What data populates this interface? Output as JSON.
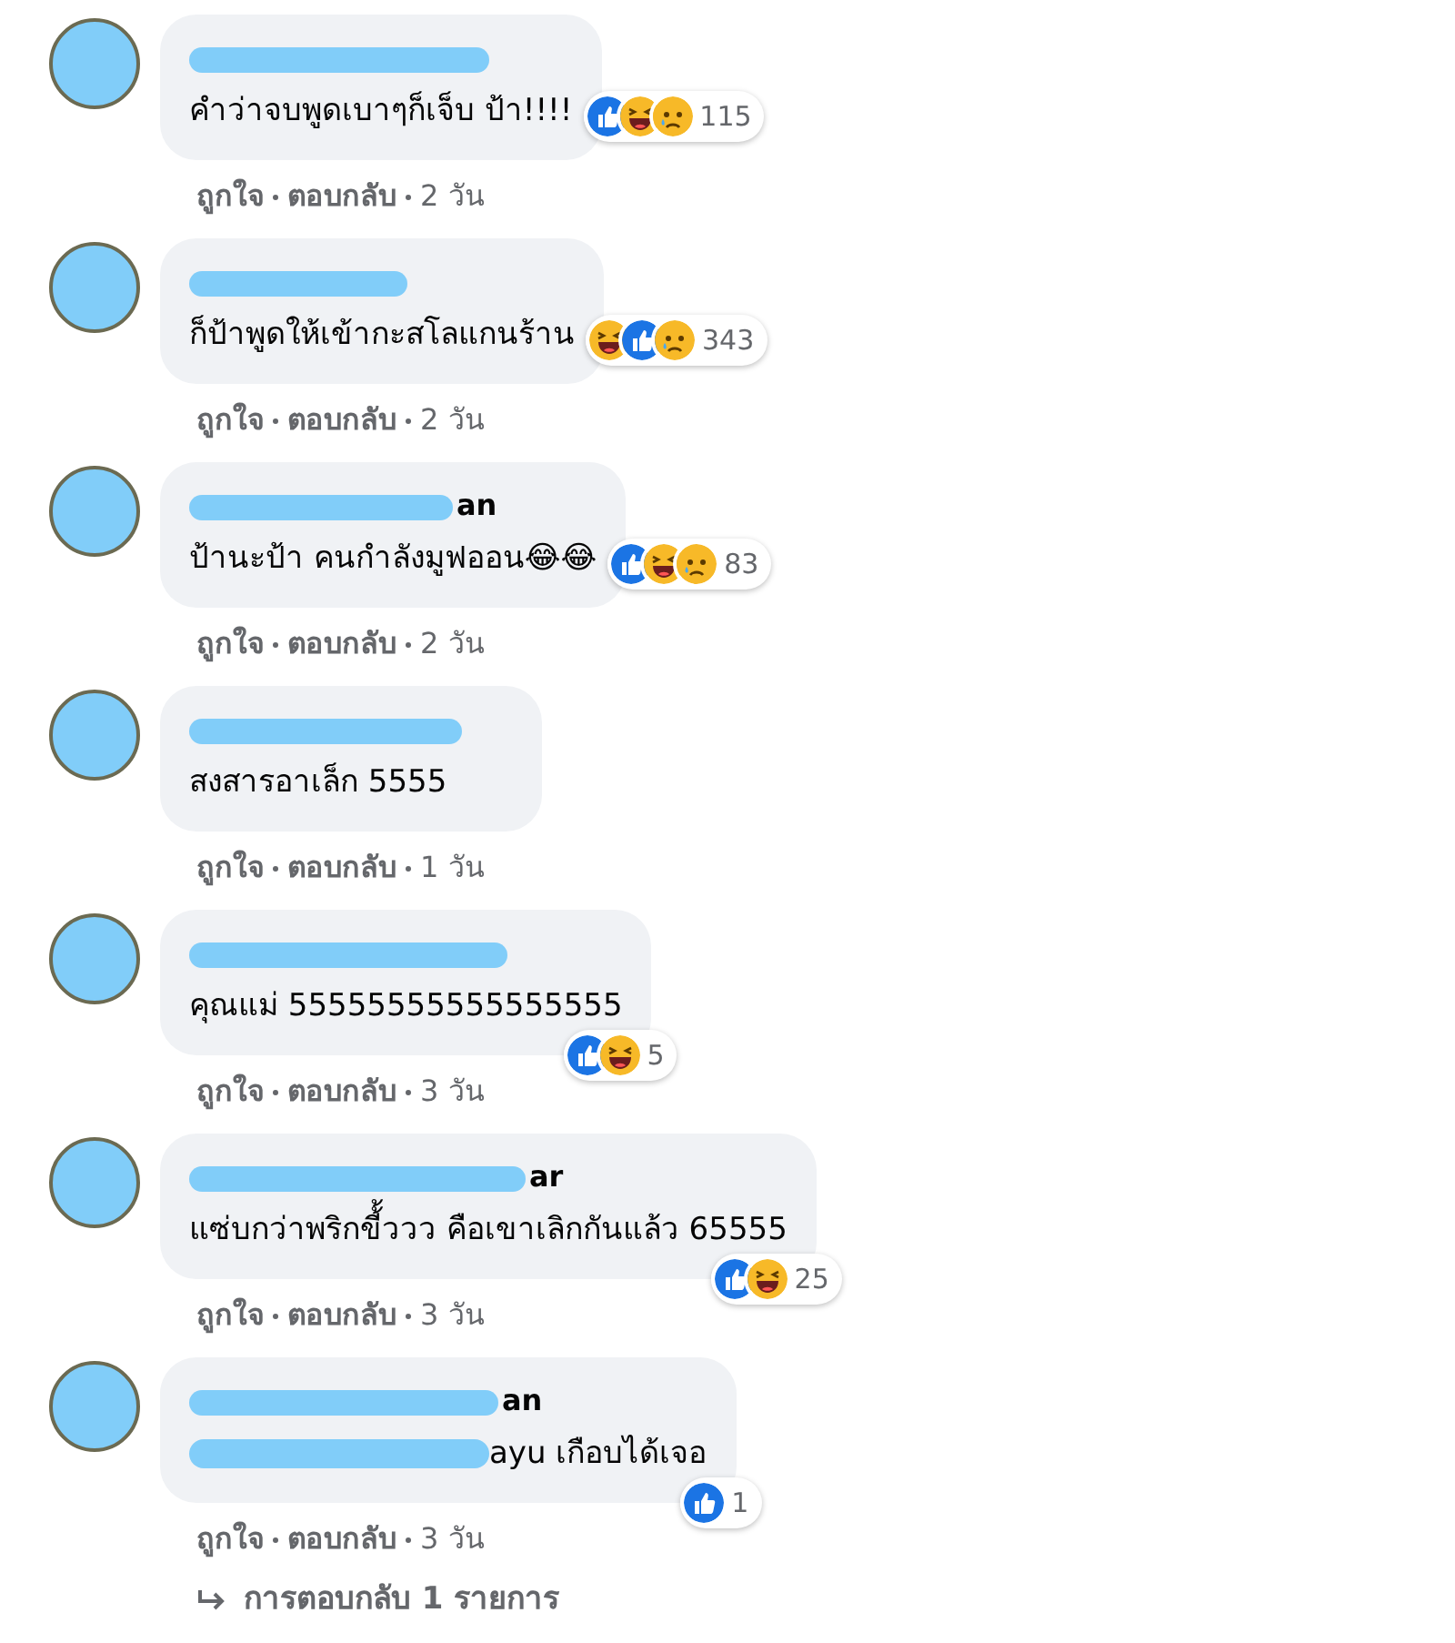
{
  "comments": [
    {
      "text": "คำว่าจบพูดเบาๆก็เจ็บ ป้า!!!!",
      "reactions_beside_text": true,
      "reactions": [
        {
          "kind": "like"
        },
        {
          "kind": "haha"
        },
        {
          "kind": "sad"
        }
      ],
      "reaction_count": "115",
      "actions": [
        "ถูกใจ",
        "ตอบกลับ",
        "2 วัน"
      ]
    },
    {
      "text": "ก็ป้าพูดให้เข้ากะสโลแกนร้าน",
      "reactions_beside_text": true,
      "reactions": [
        {
          "kind": "haha"
        },
        {
          "kind": "like"
        },
        {
          "kind": "sad"
        }
      ],
      "reaction_count": "343",
      "actions": [
        "ถูกใจ",
        "ตอบกลับ",
        "2 วัน"
      ]
    },
    {
      "name_visible": "an",
      "text": "ป้านะป้า คนกำลังมูฟออน😂😂",
      "reactions_beside_text": true,
      "reactions": [
        {
          "kind": "like"
        },
        {
          "kind": "haha"
        },
        {
          "kind": "sad"
        }
      ],
      "reaction_count": "83",
      "actions": [
        "ถูกใจ",
        "ตอบกลับ",
        "2 วัน"
      ]
    },
    {
      "text": "สงสารอาเล็ก 5555",
      "actions": [
        "ถูกใจ",
        "ตอบกลับ",
        "1 วัน"
      ]
    },
    {
      "text": "คุณแม่ 55555555555555555",
      "reactions_beside_text": false,
      "reactions": [
        {
          "kind": "like"
        },
        {
          "kind": "haha"
        }
      ],
      "reaction_count": "5",
      "actions": [
        "ถูกใจ",
        "ตอบกลับ",
        "3 วัน"
      ]
    },
    {
      "name_visible": "ar",
      "text": "แซ่บกว่าพริกขี้้ววว คือเขาเลิกกันแล้ว 65555",
      "reactions_beside_text": false,
      "reactions": [
        {
          "kind": "like"
        },
        {
          "kind": "haha"
        }
      ],
      "reaction_count": "25",
      "actions": [
        "ถูกใจ",
        "ตอบกลับ",
        "3 วัน"
      ]
    },
    {
      "name_visible": "an",
      "text_redacted": true,
      "text": "ayu เกือบได้เจอ",
      "reactions_beside_text": false,
      "reactions": [
        {
          "kind": "like"
        }
      ],
      "reaction_count": "1",
      "actions": [
        "ถูกใจ",
        "ตอบกลับ",
        "3 วัน"
      ]
    }
  ],
  "replies_link": "การตอบกลับ 1 รายการ"
}
